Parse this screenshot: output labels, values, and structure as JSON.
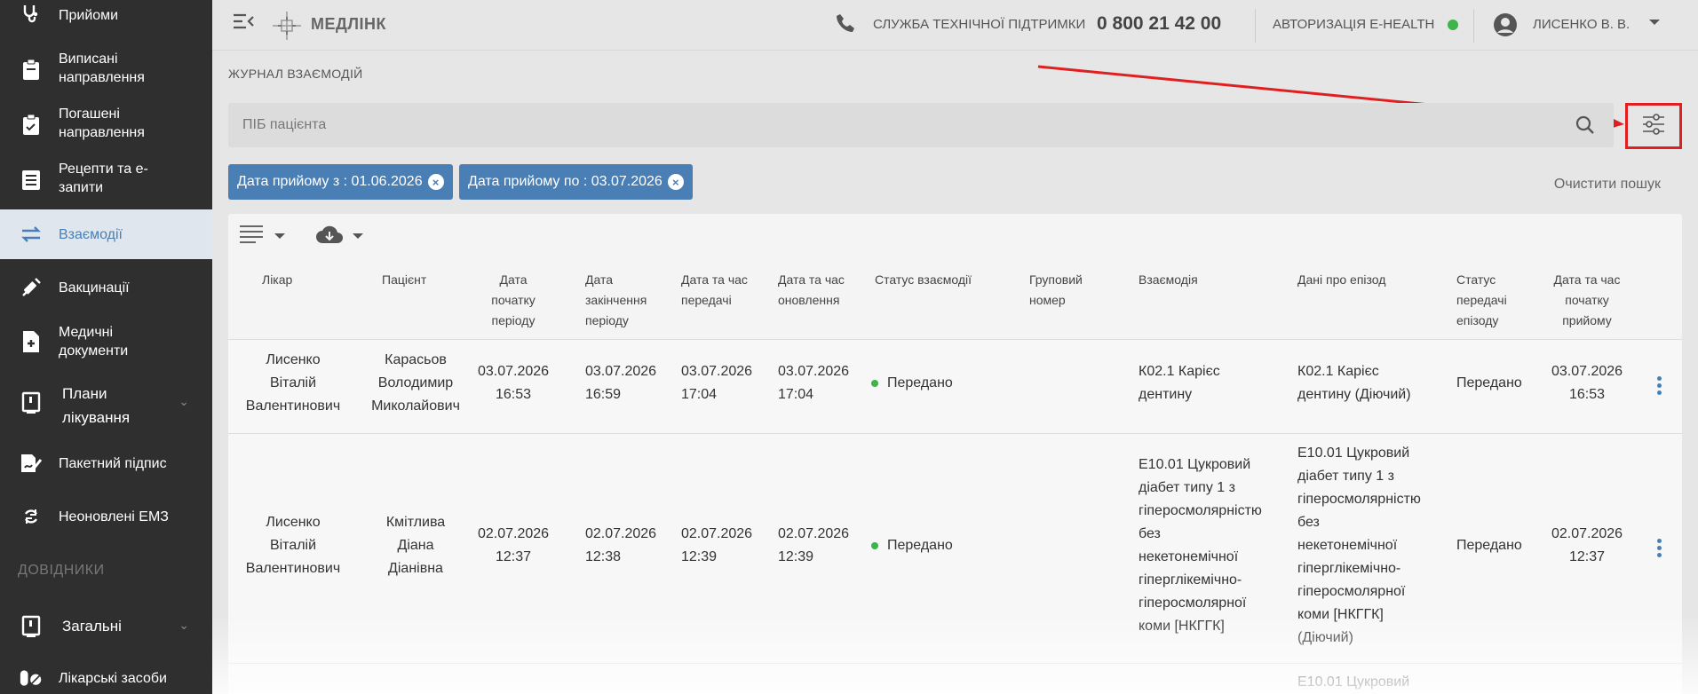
{
  "sidebar": {
    "items": [
      {
        "label": "Прийоми",
        "icon": "stethoscope-icon"
      },
      {
        "label": "Виписані\nнаправлення",
        "icon": "clipboard-icon"
      },
      {
        "label": "Погашені\nнаправлення",
        "icon": "clipboard-check-icon"
      },
      {
        "label": "Рецепти та е-\nзапити",
        "icon": "list-doc-icon"
      },
      {
        "label": "Взаємодії",
        "icon": "swap-arrows-icon",
        "active": true
      },
      {
        "label": "Вакцинації",
        "icon": "syringe-icon"
      },
      {
        "label": "Медичні\nдокументи",
        "icon": "medical-doc-icon"
      },
      {
        "label": "Плани\nлікування",
        "icon": "plan-icon"
      },
      {
        "label": "Пакетний підпис",
        "icon": "signature-icon"
      },
      {
        "label": "Неоновлені ЕМЗ",
        "icon": "refresh-icon"
      }
    ],
    "section_title": "ДОВІДНИКИ",
    "section_items": [
      {
        "label": "Загальні",
        "icon": "book-icon"
      },
      {
        "label": "Лікарські засоби",
        "icon": "pills-icon"
      }
    ]
  },
  "topbar": {
    "logo": "МЕДЛІНК",
    "support_label": "СЛУЖБА ТЕХНІЧНОЇ ПІДТРИМКИ",
    "support_phone": "0 800 21 42 00",
    "ehealth_label": "АВТОРИЗАЦІЯ E-HEALTH",
    "user_name": "ЛИСЕНКО В. В."
  },
  "page": {
    "breadcrumb": "ЖУРНАЛ ВЗАЄМОДІЙ",
    "search_placeholder": "ПІБ пацієнта",
    "chips": [
      "Дата прийому з : 01.06.2026",
      "Дата прийому по : 03.07.2026"
    ],
    "clear_search": "Очистити пошук"
  },
  "table": {
    "headers": [
      "Лікар",
      "Пацієнт",
      "Дата\nпочатку\nперіоду",
      "Дата\nзакінчення\nперіоду",
      "Дата та час\nпередачі",
      "Дата та час\nоновлення",
      "Статус взаємодії",
      "Груповий\nномер",
      "Взаємодія",
      "Дані про епізод",
      "Статус\nпередачі\nепізоду",
      "Дата та час\nпочатку\nприйому"
    ],
    "rows": [
      {
        "doctor": "Лисенко\nВіталій\nВалентинович",
        "patient": "Карасьов\nВолодимир\nМиколайович",
        "start": "03.07.2026\n16:53",
        "end": "03.07.2026\n16:59",
        "sent": "03.07.2026\n17:04",
        "updated": "03.07.2026\n17:04",
        "status": "Передано",
        "group": "",
        "interaction": "К02.1 Карієс\nдентину",
        "episode": "К02.1 Карієс\nдентину (Діючий)",
        "episode_status": "Передано",
        "visit_start": "03.07.2026\n16:53"
      },
      {
        "doctor": "Лисенко\nВіталій\nВалентинович",
        "patient": "Кмітлива\nДіана\nДіанівна",
        "start": "02.07.2026\n12:37",
        "end": "02.07.2026\n12:38",
        "sent": "02.07.2026\n12:39",
        "updated": "02.07.2026\n12:39",
        "status": "Передано",
        "group": "",
        "interaction": "E10.01 Цукровий\nдіабет типу 1 з\nгіперосмолярністю\nбез\nнекетонемічної\nгіперглікемічно-\nгіперосмолярної\nкоми [НКГГК]",
        "episode": "E10.01 Цукровий\nдіабет типу 1 з\nгіперосмолярністю\nбез\nнекетонемічної\nгіперглікемічно-\nгіперосмолярної\nкоми [НКГГК]\n(Діючий)",
        "episode_status": "Передано",
        "visit_start": "02.07.2026\n12:37"
      },
      {
        "episode": "E10.01 Цукровий"
      }
    ]
  },
  "colors": {
    "accent": "#4a7fb5",
    "sidebar": "#2f2f2f",
    "status_ok": "#3cb54a",
    "highlight": "#e02020"
  }
}
